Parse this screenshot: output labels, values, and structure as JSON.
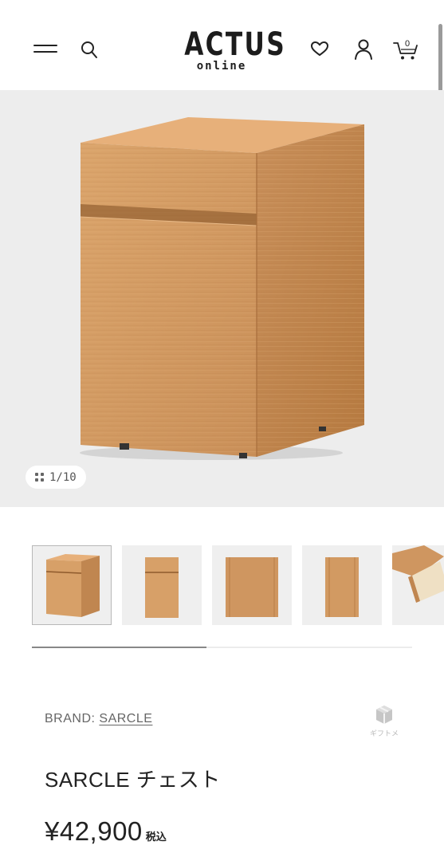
{
  "header": {
    "logo_main": "ACTUS",
    "logo_sub": "online",
    "cart_count": "0",
    "icons": [
      "menu-icon",
      "search-icon",
      "heart-icon",
      "account-icon",
      "cart-icon"
    ]
  },
  "gallery": {
    "counter": "1/10",
    "current_index": 1,
    "total": 10,
    "progress": 0.46,
    "thumbnail_count": 5
  },
  "product": {
    "brand_label": "BRAND:",
    "brand_name": "SARCLE",
    "name": "SARCLE チェスト",
    "price": "¥42,900",
    "tax_label": "税込",
    "gift_label": "ギフトメ"
  },
  "colors": {
    "wood": "#d49d66",
    "wood_dark": "#b97d47",
    "image_bg": "#ededed",
    "text": "#222222"
  }
}
